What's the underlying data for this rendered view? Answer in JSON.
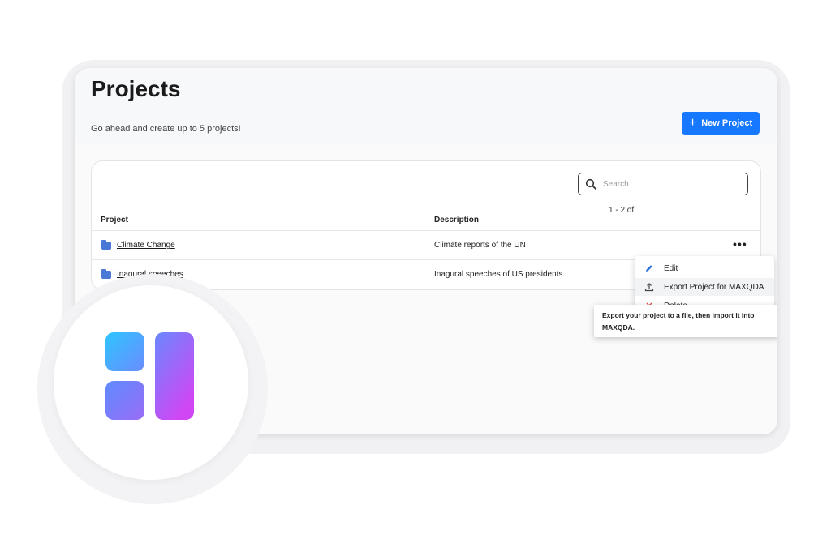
{
  "header": {
    "title": "Projects",
    "subtitle": "Go ahead and create up to 5 projects!",
    "new_button_label": "New Project"
  },
  "search": {
    "placeholder": "Search"
  },
  "table": {
    "columns": [
      "Project",
      "Description"
    ],
    "rows": [
      {
        "name": "Climate Change",
        "description": "Climate reports of the UN"
      },
      {
        "name": "Inagural speeches",
        "description": "Inagural speeches of US presidents"
      }
    ],
    "pagination_text": "1 - 2 of"
  },
  "context_menu": {
    "items": [
      {
        "label": "Edit",
        "icon": "pencil-icon"
      },
      {
        "label": "Export Project for MAXQDA",
        "icon": "upload-icon"
      },
      {
        "label": "Delete",
        "icon": "close-icon"
      }
    ]
  },
  "tooltip": {
    "text": "Export your project to a file, then import it into MAXQDA."
  },
  "colors": {
    "accent": "#1677ff",
    "folder": "#4a78d6",
    "edit_icon": "#2f6fdf",
    "delete_icon": "#e5484d",
    "logo_gradient_start": "#2ec5ff",
    "logo_gradient_end": "#d146f4"
  }
}
